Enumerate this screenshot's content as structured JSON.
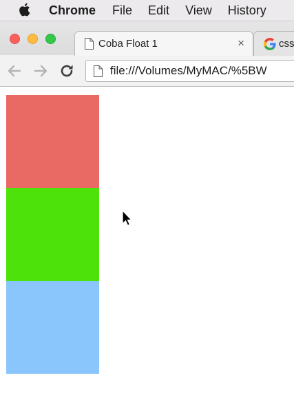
{
  "menubar": {
    "apple_icon": "apple-icon",
    "items": [
      "Chrome",
      "File",
      "Edit",
      "View",
      "History"
    ]
  },
  "tabs": [
    {
      "title": "Coba Float 1",
      "icon": "document-icon",
      "close": "×",
      "active": true
    },
    {
      "title": "css",
      "icon": "google-icon",
      "active": false
    }
  ],
  "window_controls": {
    "close_color": "#fc605c",
    "minimize_color": "#fdbc40",
    "maximize_color": "#34c84a"
  },
  "toolbar": {
    "back_icon": "arrow-left-icon",
    "forward_icon": "arrow-right-icon",
    "reload_icon": "reload-icon",
    "url": "file:///Volumes/MyMAC/%5BW"
  },
  "page": {
    "boxes": [
      {
        "name": "red-box",
        "color": "#e96a65"
      },
      {
        "name": "green-box",
        "color": "#4de30a"
      },
      {
        "name": "blue-box",
        "color": "#8ac6fb"
      }
    ]
  }
}
